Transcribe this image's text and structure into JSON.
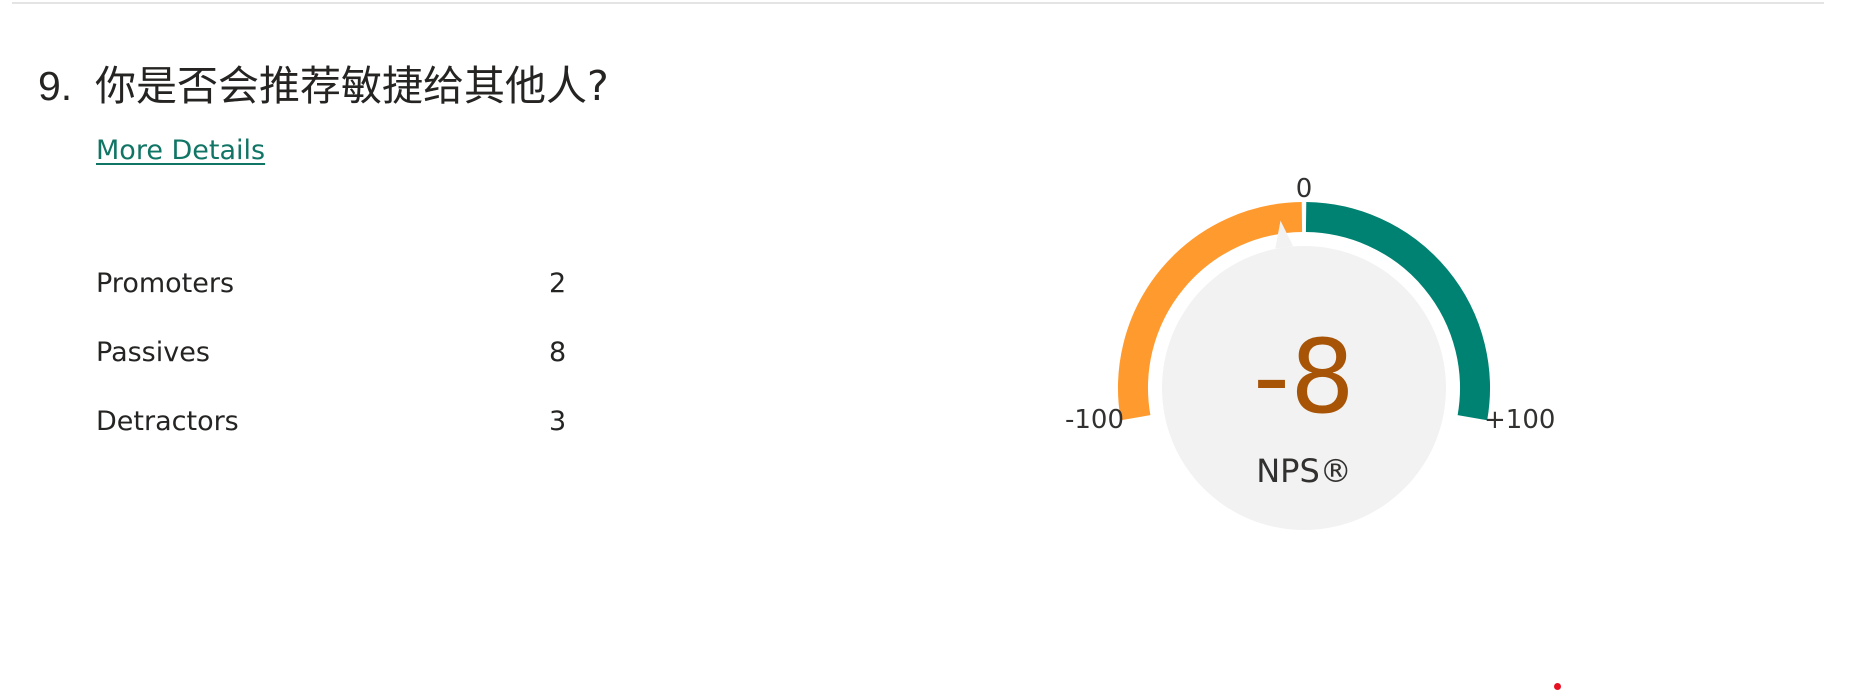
{
  "question": {
    "number": "9.",
    "text": "你是否会推荐敏捷给其他人?"
  },
  "more_details_label": "More Details",
  "stats": [
    {
      "label": "Promoters",
      "value": "2"
    },
    {
      "label": "Passives",
      "value": "8"
    },
    {
      "label": "Detractors",
      "value": "3"
    }
  ],
  "gauge": {
    "score": "-8",
    "score_value": -8,
    "caption": "NPS®",
    "label_min": "-100",
    "label_mid": "0",
    "label_max": "+100",
    "min": -100,
    "max": 100,
    "detractor_color": "#ff9a2e",
    "promoter_color": "#008272",
    "center_fill": "#f2f2f2",
    "score_color": "#a75407"
  },
  "colors": {
    "link": "#107565",
    "divider": "#e4e4e4"
  }
}
